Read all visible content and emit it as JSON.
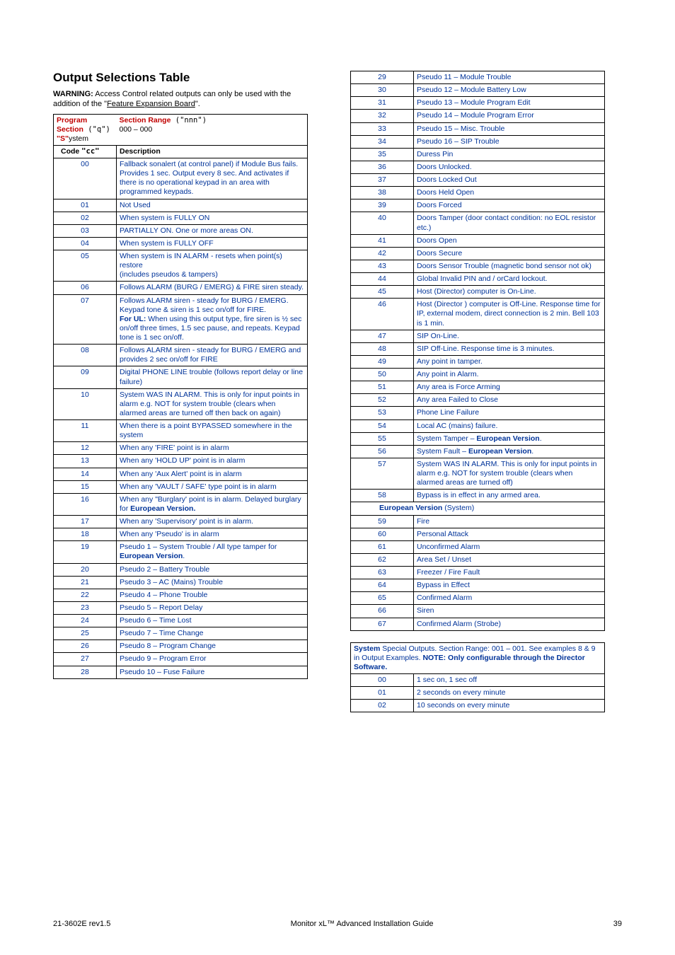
{
  "heading": "Output Selections Table",
  "warning_label": "WARNING:",
  "warning_text": " Access Control related outputs can only be used with the addition of the \"",
  "warning_link": "Feature Expansion Board",
  "warning_end": "\".",
  "t1_header": {
    "program_section_label": "Program Section",
    "program_section_code": " (\"q\")",
    "system_label": "\"S\"",
    "system_suffix": "ystem",
    "section_range_label": "Section Range",
    "section_range_code": " (\"nnn\")",
    "range_value": "000 – 000",
    "code_label": "Code ",
    "code_code": "\"cc\"",
    "desc_label": "Description"
  },
  "t1_rows": [
    {
      "c": "00",
      "d": "Fallback sonalert (at control panel) if Module Bus fails. Provides 1 sec. Output every 8 sec. And activates if there is no operational keypad in an area with programmed keypads."
    },
    {
      "c": "01",
      "d": "Not Used"
    },
    {
      "c": "02",
      "d": "When system is FULLY ON"
    },
    {
      "c": "03",
      "d": "PARTIALLY ON. One or more areas ON."
    },
    {
      "c": "04",
      "d": "When system is FULLY OFF"
    },
    {
      "c": "05",
      "d": "When system is IN ALARM - resets when point(s) restore\n(includes pseudos & tampers)"
    },
    {
      "c": "06",
      "d": "Follows ALARM (BURG / EMERG) & FIRE siren steady."
    },
    {
      "c": "07",
      "d": "Follows ALARM siren - steady for BURG / EMERG. Keypad tone & siren is 1 sec on/off for FIRE.\n|For UL:|  When using this output type, fire siren is ½ sec on/off three times, 1.5 sec pause, and repeats. Keypad tone is 1 sec on/off."
    },
    {
      "c": "08",
      "d": "Follows ALARM siren - steady for BURG / EMERG and provides 2 sec on/off for FIRE"
    },
    {
      "c": "09",
      "d": "Digital PHONE LINE trouble (follows report delay or line failure)"
    },
    {
      "c": "10",
      "d": "System WAS IN ALARM. This is only for input points in alarm e.g. NOT for system trouble (clears when alarmed areas are turned off then back on again)"
    },
    {
      "c": "11",
      "d": "When there is a point BYPASSED somewhere in the system"
    },
    {
      "c": "12",
      "d": "When any 'FIRE' point is in alarm"
    },
    {
      "c": "13",
      "d": "When any 'HOLD UP' point is in alarm"
    },
    {
      "c": "14",
      "d": "When any 'Aux Alert' point is in alarm"
    },
    {
      "c": "15",
      "d": "When any 'VAULT / SAFE' type point is in alarm"
    },
    {
      "c": "16",
      "d": "When any \"Burglary' point is in alarm. Delayed burglary for |European Version.|"
    },
    {
      "c": "17",
      "d": "When any 'Supervisory' point is in alarm."
    },
    {
      "c": "18",
      "d": "When any 'Pseudo' is in alarm"
    },
    {
      "c": "19",
      "d": "Pseudo 1 – System Trouble / All type tamper for |European Version|."
    },
    {
      "c": "20",
      "d": "Pseudo 2 – Battery Trouble"
    },
    {
      "c": "21",
      "d": "Pseudo 3 – AC (Mains) Trouble"
    },
    {
      "c": "22",
      "d": "Pseudo 4 – Phone Trouble"
    },
    {
      "c": "23",
      "d": "Pseudo 5 – Report Delay"
    },
    {
      "c": "24",
      "d": "Pseudo 6 – Time Lost"
    },
    {
      "c": "25",
      "d": "Pseudo 7 – Time Change"
    },
    {
      "c": "26",
      "d": "Pseudo 8 – Program Change"
    },
    {
      "c": "27",
      "d": "Pseudo 9 – Program Error"
    },
    {
      "c": "28",
      "d": "Pseudo 10 – Fuse Failure"
    }
  ],
  "t2_rows": [
    {
      "c": "29",
      "d": "Pseudo 11 – Module Trouble"
    },
    {
      "c": "30",
      "d": "Pseudo 12 – Module Battery Low"
    },
    {
      "c": "31",
      "d": "Pseudo 13 – Module Program Edit"
    },
    {
      "c": "32",
      "d": "Pseudo 14 – Module Program Error"
    },
    {
      "c": "33",
      "d": "Pseudo 15 – Misc. Trouble"
    },
    {
      "c": "34",
      "d": "Pseudo 16 – SIP Trouble"
    },
    {
      "c": "35",
      "d": "Duress Pin"
    },
    {
      "c": "36",
      "d": "Doors Unlocked."
    },
    {
      "c": "37",
      "d": "Doors Locked Out"
    },
    {
      "c": "38",
      "d": "Doors Held Open"
    },
    {
      "c": "39",
      "d": "Doors Forced"
    },
    {
      "c": "40",
      "d": "Doors Tamper (door contact condition: no EOL resistor etc.)"
    },
    {
      "c": "41",
      "d": "Doors Open"
    },
    {
      "c": "42",
      "d": "Doors Secure"
    },
    {
      "c": "43",
      "d": "Doors Sensor Trouble (magnetic bond sensor not ok)"
    },
    {
      "c": "44",
      "d": "Global Invalid PIN and / orCard lockout."
    },
    {
      "c": "45",
      "d": "Host (Director) computer is On-Line."
    },
    {
      "c": "46",
      "d": "Host (Director ) computer is Off-Line. Response time for IP, external modem, direct connection is 2 min. Bell 103 is 1 min."
    },
    {
      "c": "47",
      "d": "SIP On-Line."
    },
    {
      "c": "48",
      "d": "SIP Off-Line. Response time is 3 minutes."
    },
    {
      "c": "49",
      "d": "Any point in tamper."
    },
    {
      "c": "50",
      "d": "Any point in Alarm."
    },
    {
      "c": "51",
      "d": "Any area is Force Arming"
    },
    {
      "c": "52",
      "d": "Any area Failed to Close"
    },
    {
      "c": "53",
      "d": "Phone Line Failure"
    },
    {
      "c": "54",
      "d": "Local AC (mains) failure."
    },
    {
      "c": "55",
      "d": "System Tamper – |European Version|."
    },
    {
      "c": "56",
      "d": "System Fault – |European Version|."
    },
    {
      "c": "57",
      "d": "System WAS IN ALARM. This is only for input points in alarm e.g. NOT for system trouble (clears when alarmed areas are turned off)"
    },
    {
      "c": "58",
      "d": "Bypass is in effect in any armed area."
    }
  ],
  "euro_section_label": "European Version",
  "euro_section_suffix": "  (System)",
  "t2_euro_rows": [
    {
      "c": "59",
      "d": "Fire"
    },
    {
      "c": "60",
      "d": "Personal Attack"
    },
    {
      "c": "61",
      "d": "Unconfirmed Alarm"
    },
    {
      "c": "62",
      "d": "Area Set / Unset"
    },
    {
      "c": "63",
      "d": "Freezer / Fire Fault"
    },
    {
      "c": "64",
      "d": "Bypass in Effect"
    },
    {
      "c": "65",
      "d": "Confirmed Alarm"
    },
    {
      "c": "66",
      "d": "Siren"
    },
    {
      "c": "67",
      "d": "Confirmed Alarm (Strobe)"
    }
  ],
  "t3_header": {
    "system_bold": "System",
    "line1": " Special Outputs. Section Range: 001 – 001. See examples 8 & 9 in Output Examples. ",
    "note_bold": "NOTE: Only configurable through the Director Software."
  },
  "t3_rows": [
    {
      "c": "00",
      "d": "1 sec on, 1 sec off"
    },
    {
      "c": "01",
      "d": "2 seconds on every minute"
    },
    {
      "c": "02",
      "d": "10 seconds on every minute"
    }
  ],
  "footer": {
    "left": "21-3602E rev1.5",
    "center": "Monitor xL™ Advanced Installation Guide",
    "right": "39"
  }
}
